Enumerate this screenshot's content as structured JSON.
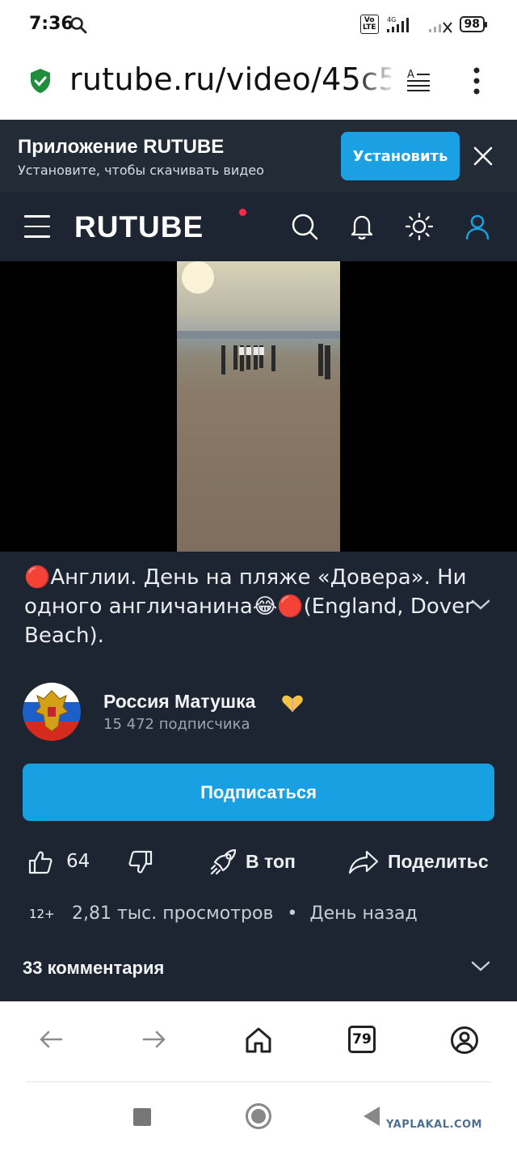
{
  "status_bar": {
    "time": "7:36",
    "network": "4G",
    "volte": "Vo\nLTE",
    "battery": "98"
  },
  "url_bar": {
    "url": "rutube.ru/video/45c5"
  },
  "app_banner": {
    "title": "Приложение RUTUBE",
    "subtitle": "Установите, чтобы скачивать видео",
    "install_label": "Установить"
  },
  "header": {
    "logo": "RUTUBE",
    "accent": "#ff2a48"
  },
  "video": {
    "title": "🔴Англии. День на пляже «Довера». Ни одного англичанина😂🔴(England, Dover Beach)."
  },
  "channel": {
    "name": "Россия Матушка",
    "subscribers": "15 472 подписчика",
    "subscribe_label": "Подписаться"
  },
  "actions": {
    "likes": "64",
    "top_label": "В топ",
    "share_label": "Поделитьс"
  },
  "meta": {
    "age_rating": "12+",
    "views": "2,81 тыс. просмотров",
    "separator": "•",
    "date": "День назад"
  },
  "comments": {
    "label": "33 комментария"
  },
  "browser_bar": {
    "tabs_count": "79"
  },
  "watermark": "YAPLAKAL.COM",
  "colors": {
    "primary": "#1aa0e3",
    "dark_bg": "#1c2531",
    "banner_bg": "#222b36"
  }
}
